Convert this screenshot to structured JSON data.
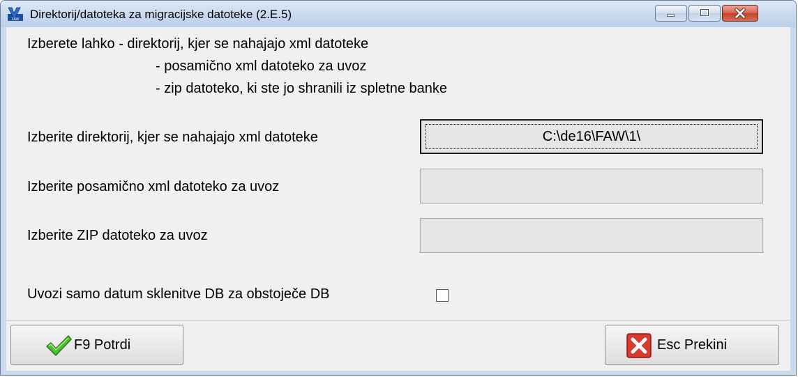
{
  "window": {
    "title": "Direktorij/datoteka za migracijske datoteke  (2.E.5)",
    "app_icon": "faw-app-icon",
    "controls": [
      "minimize-icon",
      "maximize-icon",
      "close-icon"
    ]
  },
  "info": {
    "line1": "Izberete lahko - direktorij, kjer se nahajajo xml datoteke",
    "line2": "- posamično xml datoteko za uvoz",
    "line3": "- zip datoteko, ki ste jo shranili iz spletne banke"
  },
  "fields": {
    "directory": {
      "label": "Izberite direktorij, kjer se nahajajo xml datoteke",
      "value": "C:\\de16\\FAW\\1\\"
    },
    "xml_file": {
      "label": "Izberite posamično xml datoteko za uvoz",
      "value": ""
    },
    "zip_file": {
      "label": "Izberite ZIP datoteko za uvoz",
      "value": ""
    },
    "date_only": {
      "label": "Uvozi samo datum sklenitve DB za obstoječe DB",
      "checked": false
    }
  },
  "buttons": {
    "confirm": {
      "label": "F9 Potrdi",
      "icon": "checkmark-icon",
      "color": "#3fae2a"
    },
    "cancel": {
      "label": "Esc Prekini",
      "icon": "red-x-icon",
      "color": "#d83a2e"
    }
  }
}
